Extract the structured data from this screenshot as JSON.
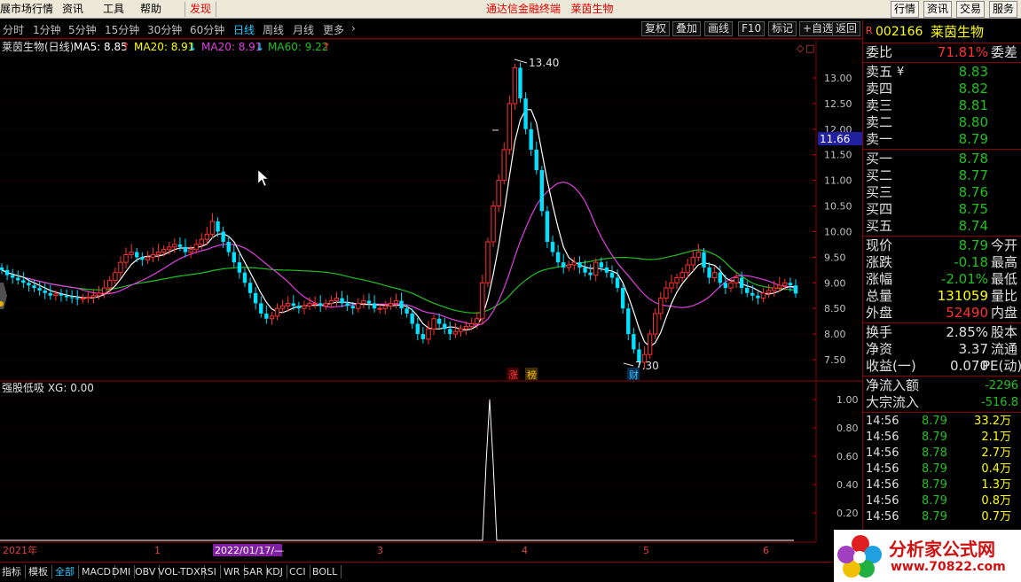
{
  "menubar": {
    "items": [
      "展市场行情",
      "资讯",
      "工具",
      "帮助"
    ],
    "discover": "发现",
    "title_left": "通达信金融终端",
    "title_right": "莱茵生物",
    "right_buttons": [
      "行情",
      "资讯",
      "交易",
      "服务"
    ]
  },
  "periods": [
    "分时",
    "1分钟",
    "5分钟",
    "15分钟",
    "30分钟",
    "60分钟",
    "日线",
    "周线",
    "月线",
    "更多"
  ],
  "period_selected": "日线",
  "tools": [
    "复权",
    "叠加",
    "画线",
    "F10",
    "标记",
    "+自选",
    "返回"
  ],
  "main_legend": {
    "name": "莱茵生物(日线)",
    "ma5": "MA5: 8.85",
    "ma20a": "MA20: 8.91",
    "ma20b": "MA20: 8.91",
    "ma60": "MA60: 9.22"
  },
  "sub_legend": "强股低吸 XG: 0.00",
  "price_axis": [
    "13.00",
    "12.50",
    "12.00",
    "11.50",
    "11.00",
    "10.50",
    "10.00",
    "9.50",
    "9.00",
    "8.50",
    "8.00",
    "7.50"
  ],
  "sub_axis": [
    "1.00",
    "0.80",
    "0.60",
    "0.40",
    "0.20"
  ],
  "current_price_tag": "11.66",
  "annotations": {
    "high": "13.40",
    "low": "7.30",
    "tag1": "涨",
    "tag2": "榜",
    "tag3": "财"
  },
  "time_axis": {
    "year": "2021年",
    "m1": "1",
    "date": "2022/01/17/—",
    "m3": "3",
    "m4": "4",
    "m5": "5",
    "m6": "6"
  },
  "indicators": [
    "指标",
    "模板",
    "全部",
    "MACD",
    "DMI",
    "OBV",
    "VOL-TDX",
    "RSI",
    "WR",
    "SAR",
    "KDJ",
    "CCI",
    "BOLL"
  ],
  "indicator_selected": "全部",
  "panel": {
    "r_badge": "R",
    "code": "002166",
    "name": "莱茵生物",
    "webi_label": "委比",
    "webi_value": "71.81%",
    "weicha_label": "委差",
    "sell": [
      {
        "label": "卖五",
        "price": "8.83"
      },
      {
        "label": "卖四",
        "price": "8.82"
      },
      {
        "label": "卖三",
        "price": "8.81"
      },
      {
        "label": "卖二",
        "price": "8.80"
      },
      {
        "label": "卖一",
        "price": "8.79"
      }
    ],
    "buy": [
      {
        "label": "买一",
        "price": "8.78"
      },
      {
        "label": "买二",
        "price": "8.77"
      },
      {
        "label": "买三",
        "price": "8.76"
      },
      {
        "label": "买四",
        "price": "8.75"
      },
      {
        "label": "买五",
        "price": "8.74"
      }
    ],
    "yen": "¥",
    "stats": [
      {
        "label": "现价",
        "value": "8.79",
        "label2": "今开",
        "color": "#20c020"
      },
      {
        "label": "涨跌",
        "value": "-0.18",
        "label2": "最高",
        "color": "#20c020"
      },
      {
        "label": "涨幅",
        "value": "-2.01%",
        "label2": "最低",
        "color": "#20c020"
      },
      {
        "label": "总量",
        "value": "131059",
        "label2": "量比",
        "color": "#ffff00"
      },
      {
        "label": "外盘",
        "value": "52490",
        "label2": "内盘",
        "color": "#ff3030"
      },
      {
        "label": "换手",
        "value": "2.85%",
        "label2": "股本",
        "color": "#e0e0e0"
      },
      {
        "label": "净资",
        "value": "3.37",
        "label2": "流通",
        "color": "#e0e0e0"
      },
      {
        "label": "收益(一)",
        "value": "0.070",
        "label2": "PE(动)",
        "color": "#e0e0e0"
      }
    ],
    "flows": [
      {
        "label": "净流入额",
        "value": "-2296"
      },
      {
        "label": "大宗流入",
        "value": "-516.8"
      }
    ],
    "ticks": [
      {
        "time": "14:56",
        "price": "8.79",
        "vol": "33.2万"
      },
      {
        "time": "14:56",
        "price": "8.79",
        "vol": "2.1万"
      },
      {
        "time": "14:56",
        "price": "8.78",
        "vol": "2.7万"
      },
      {
        "time": "14:56",
        "price": "8.79",
        "vol": "0.4万"
      },
      {
        "time": "14:56",
        "price": "8.79",
        "vol": "1.3万"
      },
      {
        "time": "14:56",
        "price": "8.79",
        "vol": "0.8万"
      },
      {
        "time": "14:56",
        "price": "8.79",
        "vol": "0.7万"
      }
    ]
  },
  "logo": {
    "name": "分析家公式网",
    "url": "www.70822.com"
  },
  "colors": {
    "up": "#ff3030",
    "down": "#00e0ff",
    "ma5": "#ffffff",
    "ma20": "#e040e0",
    "ma60": "#20c020",
    "menu_red": "#e00000"
  }
}
